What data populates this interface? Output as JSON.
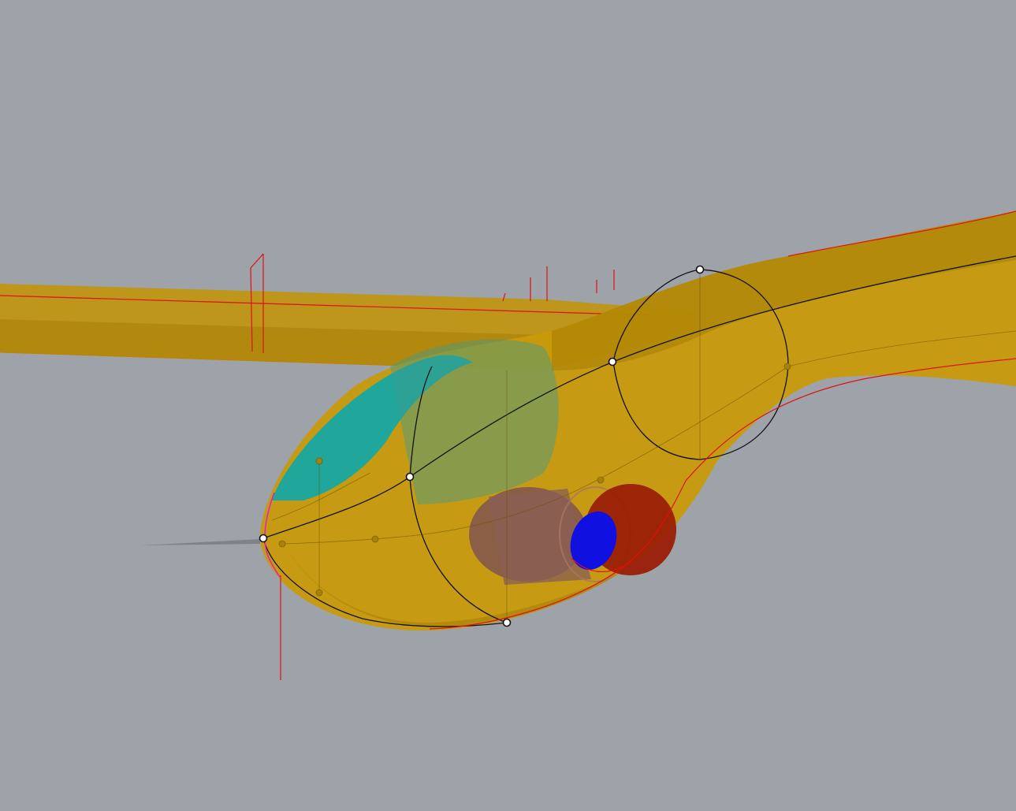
{
  "viewport": {
    "background": "#9ea3aa",
    "colors": {
      "fuselage": "#c99a07",
      "fuselage_dark": "#a07a02",
      "wing": "#c29407",
      "canopy": "#12a7a7",
      "nacelle": "#7f5550",
      "intake_outer": "#9a1e06",
      "intake_inner": "#1010e0",
      "section_curve": "#111111",
      "edge_curve": "#e01010",
      "seam_curve": "#e020c0"
    },
    "icons": {
      "control_point": "circle-handle-icon"
    }
  }
}
